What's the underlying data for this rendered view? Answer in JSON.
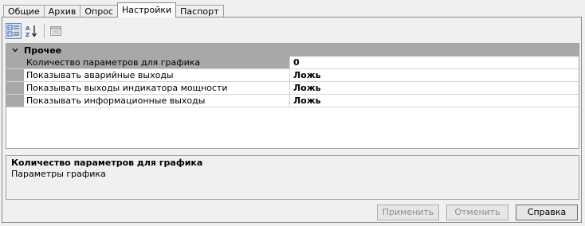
{
  "tabs": [
    {
      "label": "Общие",
      "active": false
    },
    {
      "label": "Архив",
      "active": false
    },
    {
      "label": "Опрос",
      "active": false
    },
    {
      "label": "Настройки",
      "active": true
    },
    {
      "label": "Паспорт",
      "active": false
    }
  ],
  "toolbar": {
    "buttons": [
      {
        "icon": "categorized-icon",
        "pressed": true
      },
      {
        "icon": "sort-alphabetical-icon",
        "pressed": false
      },
      {
        "icon": "property-pages-icon",
        "pressed": false
      }
    ]
  },
  "grid": {
    "category": "Прочее",
    "category_expanded": true,
    "properties": [
      {
        "name": "Количество параметров для графика",
        "value": "0",
        "selected": true
      },
      {
        "name": "Показывать аварийные выходы",
        "value": "Ложь",
        "selected": false
      },
      {
        "name": "Показывать выходы индикатора мощности",
        "value": "Ложь",
        "selected": false
      },
      {
        "name": "Показывать информационные выходы",
        "value": "Ложь",
        "selected": false
      }
    ]
  },
  "description": {
    "title": "Количество параметров для графика",
    "text": "Параметры графика"
  },
  "buttons": {
    "apply": "Применить",
    "cancel": "Отменить",
    "help": "Справка"
  },
  "colors": {
    "category_bg": "#a8a8a8",
    "selected_row_bg": "#a8a8a8",
    "grid_bg": "#ffffff",
    "window_bg": "#f0f0f0",
    "disabled_text": "#8d8d8d"
  }
}
